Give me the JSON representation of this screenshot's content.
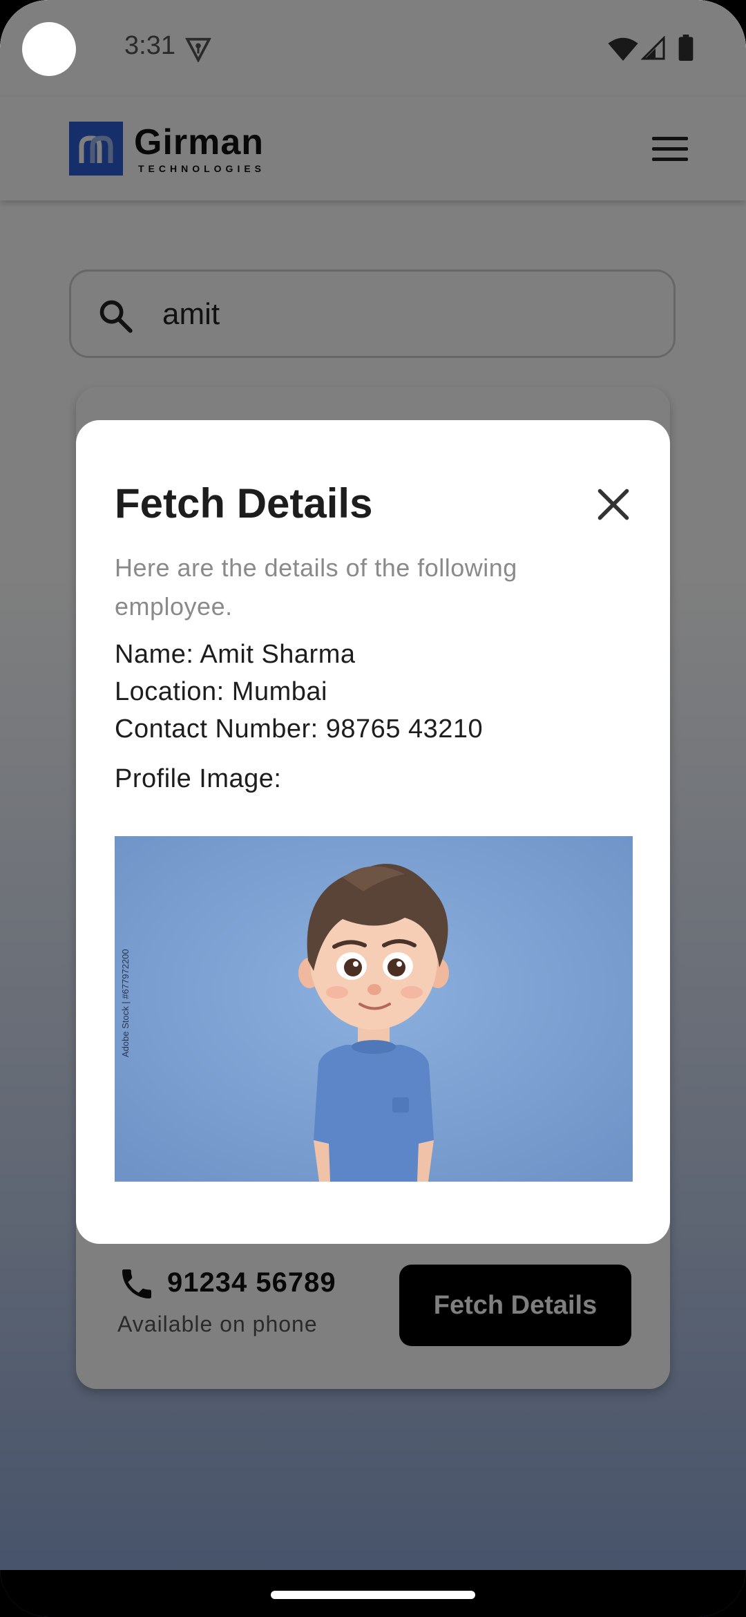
{
  "status_bar": {
    "time": "3:31",
    "icons": [
      "vpn-key-icon",
      "wifi-icon",
      "cell-signal-icon",
      "battery-icon"
    ]
  },
  "app_bar": {
    "brand_name": "Girman",
    "brand_sub": "TECHNOLOGIES",
    "menu_icon": "hamburger-menu-icon",
    "brand_color": "#2c5fd6"
  },
  "search": {
    "value": "amit",
    "icon": "search-icon"
  },
  "employee_card": {
    "phone": "91234 56789",
    "availability": "Available on phone",
    "button_label": "Fetch Details"
  },
  "dialog": {
    "title": "Fetch Details",
    "description": "Here are the details of the following employee.",
    "name_line": "Name: Amit Sharma",
    "location_line": "Location: Mumbai",
    "contact_line": "Contact Number: 98765 43210",
    "profile_label": "Profile Image:",
    "image_credit": "Adobe Stock | #677972200"
  },
  "colors": {
    "background_top": "#ffffff",
    "background_bottom": "#8aa3d3",
    "primary_button": "#000000",
    "image_background": "#7ea2d3"
  }
}
